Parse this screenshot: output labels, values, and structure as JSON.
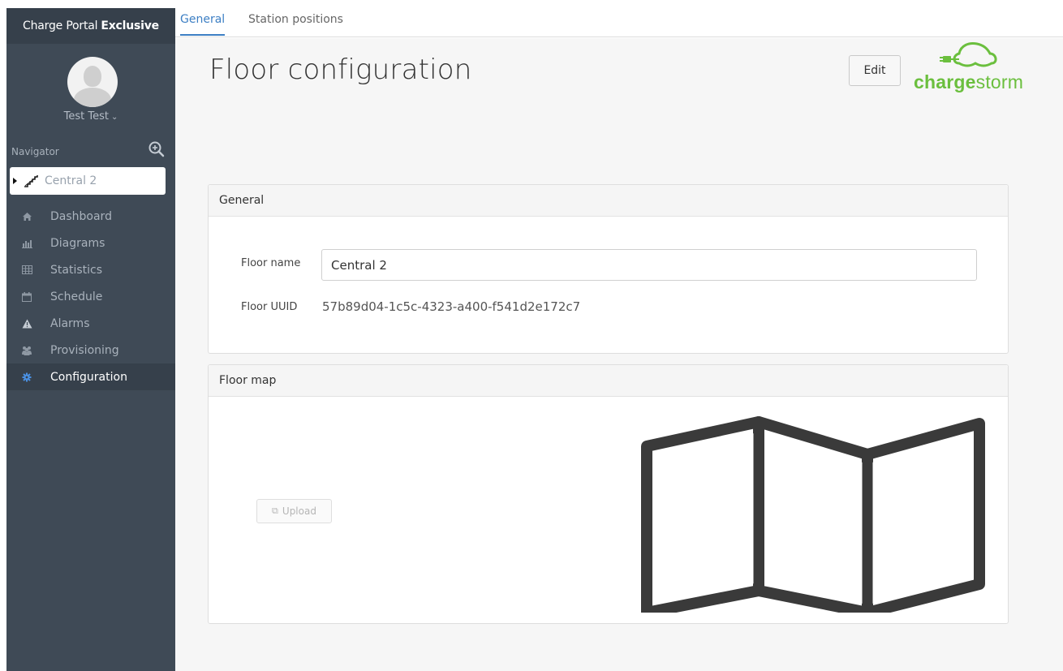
{
  "sidebar": {
    "brand_prefix": "Charge Portal",
    "brand_bold": "Exclusive",
    "user_name": "Test Test",
    "navigator_label": "Navigator",
    "tree_node": "Central 2",
    "menu": [
      {
        "label": "Dashboard",
        "icon": "home-icon"
      },
      {
        "label": "Diagrams",
        "icon": "bar-chart-icon"
      },
      {
        "label": "Statistics",
        "icon": "table-icon"
      },
      {
        "label": "Schedule",
        "icon": "calendar-icon"
      },
      {
        "label": "Alarms",
        "icon": "warning-icon"
      },
      {
        "label": "Provisioning",
        "icon": "users-icon"
      },
      {
        "label": "Configuration",
        "icon": "gear-icon",
        "active": true
      }
    ]
  },
  "tabs": [
    {
      "label": "General",
      "active": true
    },
    {
      "label": "Station positions",
      "active": false
    }
  ],
  "page": {
    "title": "Floor configuration",
    "edit_label": "Edit",
    "logo_bold": "charge",
    "logo_light": "storm"
  },
  "general_panel": {
    "heading": "General",
    "floor_name_label": "Floor name",
    "floor_name_value": "Central 2",
    "floor_uuid_label": "Floor UUID",
    "floor_uuid_value": "57b89d04-1c5c-4323-a400-f541d2e172c7"
  },
  "floormap_panel": {
    "heading": "Floor map",
    "upload_label": "Upload"
  },
  "colors": {
    "sidebar_bg": "#3f4a56",
    "accent": "#3d7fc4",
    "brand_green": "#6bbf3e"
  }
}
